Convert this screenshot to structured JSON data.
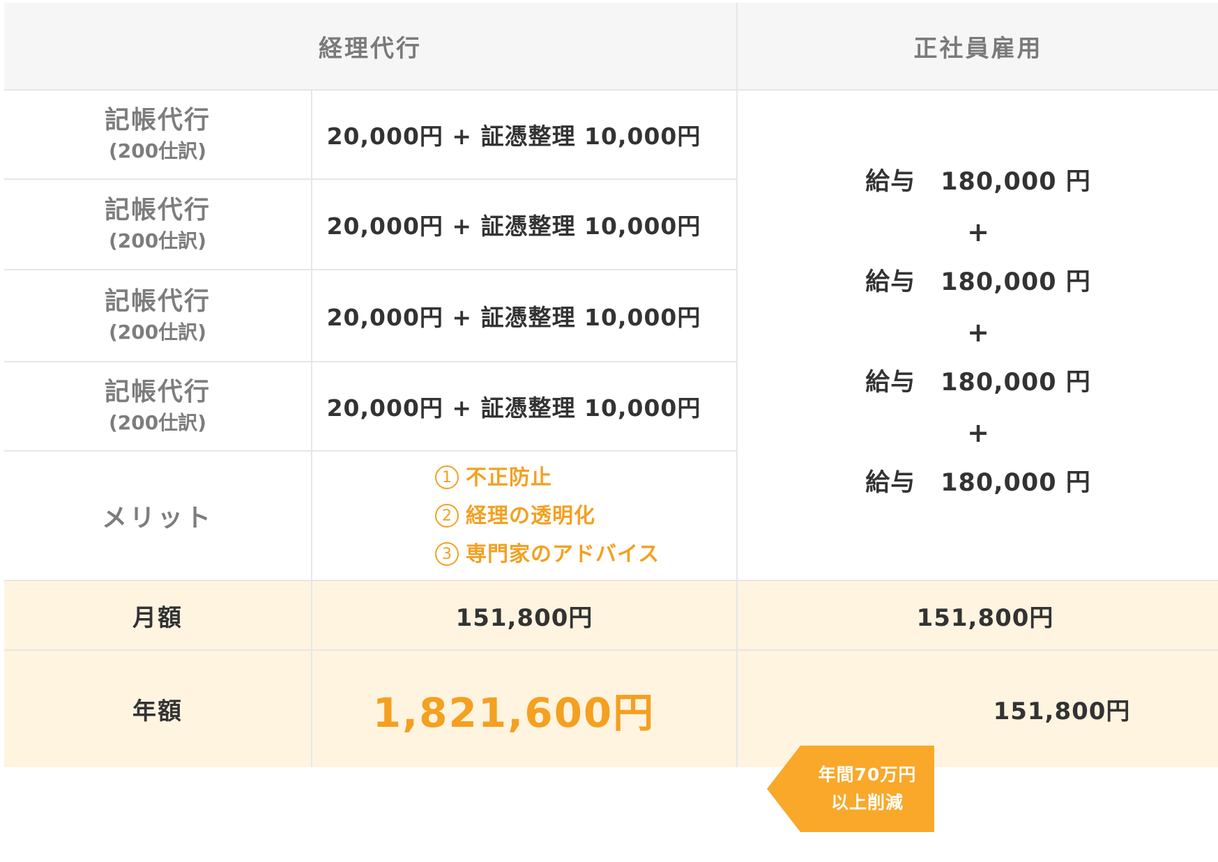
{
  "header": {
    "col_outsource": "経理代行",
    "col_employee": "正社員雇用"
  },
  "rows": [
    {
      "label": "記帳代行",
      "sub": "(200仕訳)",
      "fee": "20,000円 + 証憑整理 10,000円"
    },
    {
      "label": "記帳代行",
      "sub": "(200仕訳)",
      "fee": "20,000円 + 証憑整理 10,000円"
    },
    {
      "label": "記帳代行",
      "sub": "(200仕訳)",
      "fee": "20,000円 + 証憑整理 10,000円"
    },
    {
      "label": "記帳代行",
      "sub": "(200仕訳)",
      "fee": "20,000円 + 証憑整理 10,000円"
    }
  ],
  "salary": {
    "lines": [
      "給与　180,000 円",
      "給与　180,000 円",
      "給与　180,000 円",
      "給与　180,000 円"
    ],
    "plus": "+"
  },
  "merit": {
    "label": "メリット",
    "items": [
      {
        "num": "1",
        "text": "不正防止"
      },
      {
        "num": "2",
        "text": "経理の透明化"
      },
      {
        "num": "3",
        "text": "専門家のアドバイス"
      }
    ]
  },
  "monthly": {
    "label": "月額",
    "outsource": "151,800円",
    "employee": "151,800円"
  },
  "annual": {
    "label": "年額",
    "outsource": "1,821,600円",
    "employee": "151,800円"
  },
  "badge": {
    "line1": "年間70万円",
    "line2": "以上削減"
  },
  "colors": {
    "accent": "#f4a020",
    "header_bg": "#f6f6f6",
    "summary_bg": "#fff4e0",
    "border": "#e6e6e6"
  }
}
